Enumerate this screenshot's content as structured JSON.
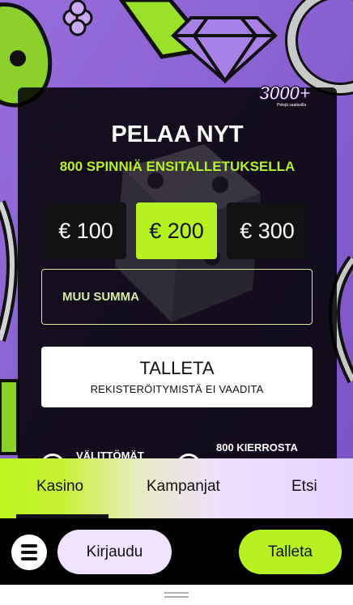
{
  "promo": {
    "badge_main": "3000+",
    "badge_sub": "Pelejä saatavilla",
    "title": "PELAA NYT",
    "subtitle": "800 SPINNIÄ ENSITALLETUKSELLA",
    "amounts": [
      "€ 100",
      "€ 200",
      "€ 300"
    ],
    "selected_amount": "€ 200",
    "other_amount_placeholder": "MUU SUMMA",
    "deposit_label": "TALLETA",
    "deposit_sub": "REKISTERÖITYMISTÄ EI VAADITA",
    "feature_left": "VÄLITTÖMÄT",
    "feature_right": "800 KIERROSTA"
  },
  "tabs": {
    "items": [
      "Kasino",
      "Kampanjat",
      "Etsi"
    ],
    "active": "Kasino"
  },
  "navbar": {
    "login_label": "Kirjaudu",
    "deposit_label": "Talleta"
  },
  "colors": {
    "accent": "#b4f321",
    "purple": "#8a5fd1",
    "card_bg": "#000000",
    "login_bg": "#f0e3ff"
  },
  "icons": {
    "menu": "hamburger-icon",
    "diamond": "diamond-icon",
    "clover": "clover-icon",
    "dice": "dice-icon"
  }
}
